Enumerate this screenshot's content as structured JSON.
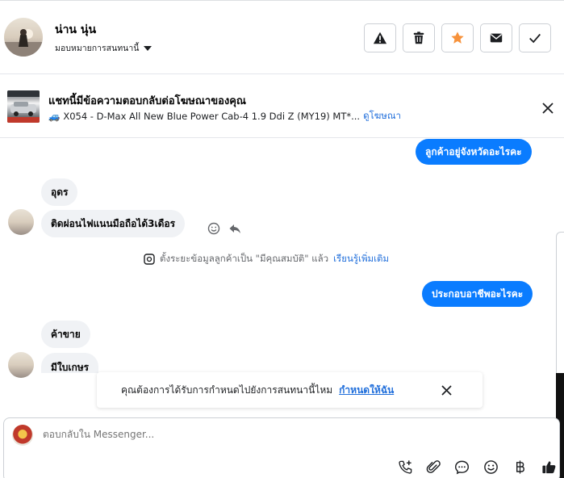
{
  "header": {
    "user_name": "น่าน นุ่น",
    "assign_label": "มอบหมายการสนทนานี้",
    "actions": [
      "warning-icon",
      "trash-icon",
      "star-icon",
      "mail-icon",
      "check-icon"
    ],
    "star_color": "#f7923b"
  },
  "ad": {
    "title": "แชทนี้มีข้อความตอบกลับต่อโฆษณาของคุณ",
    "vehicle_emoji": "🚙",
    "subtitle": "X054 - D-Max All New Blue Power Cab-4 1.9 Ddi Z (MY19) MT*...",
    "view_ad": "ดูโฆษณา"
  },
  "messages": {
    "out1": "ลูกค้าอยู่จังหวัดอะไรคะ",
    "in1": "อุดร",
    "in2": "ติดผ่อนไฟแนนมือถือได้3เดือร",
    "system": "ตั้งระยะข้อมูลลูกค้าเป็น \"มีคุณสมบัติ\" แล้ว",
    "system_link": "เรียนรู้เพิ่มเติม",
    "out2": "ประกอบอาชีพอะไรคะ",
    "in3": "ค้าขาย",
    "in4": "มีใบเกษร"
  },
  "notice": {
    "text": "คุณต้องการได้รับการกำหนดไปยังการสนทนานี้ไหม",
    "link": "กำหนดให้ฉัน"
  },
  "composer": {
    "placeholder": "ตอบกลับใน Messenger...",
    "tools": [
      "call-add-icon",
      "attachment-icon",
      "chat-bubble-icon",
      "emoji-icon",
      "baht-icon",
      "thumbs-up-icon"
    ]
  },
  "colors": {
    "accent": "#0a7cff",
    "link": "#216fdb"
  }
}
